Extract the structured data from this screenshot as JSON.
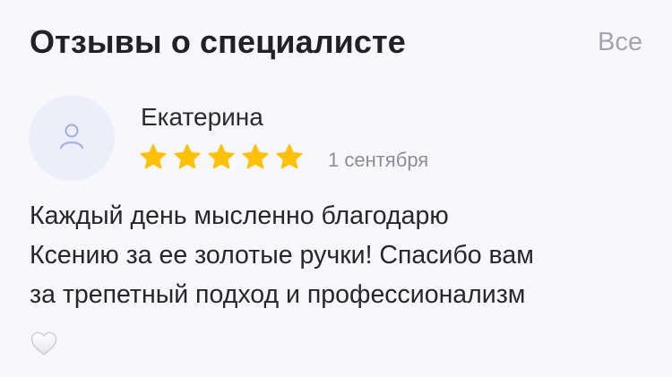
{
  "reviews_section": {
    "title": "Отзывы о специалисте",
    "see_all_label": "Все"
  },
  "review": {
    "author": "Екатерина",
    "avatar_icon": "user-icon",
    "rating": 5,
    "rating_max": 5,
    "star_color": "#ffc107",
    "date": "1 сентября",
    "text_lines": [
      "Каждый день мысленно благодарю",
      "Ксению за ее золотые ручки! Спасибо вам",
      "за трепетный подход и профессионализм"
    ],
    "emoji": "white-heart-icon"
  },
  "colors": {
    "background": "#f8f8fc",
    "avatar_bg": "#eceefa",
    "avatar_icon": "#a9b0e0",
    "muted_text": "#a4a4ae"
  }
}
